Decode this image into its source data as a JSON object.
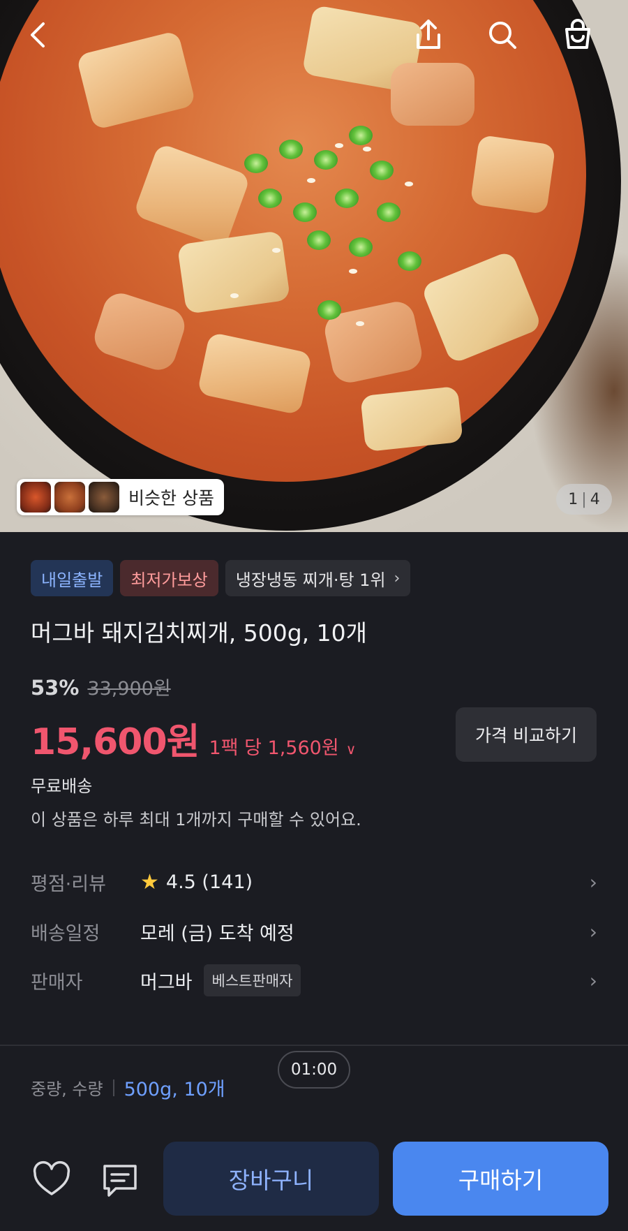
{
  "hero": {
    "similar_label": "비슷한 상품",
    "page_current": "1",
    "page_total": "4"
  },
  "badges": [
    {
      "label": "내일출발"
    },
    {
      "label": "최저가보상"
    },
    {
      "label": "냉장냉동 찌개·탕 1위"
    }
  ],
  "product": {
    "title": "머그바 돼지김치찌개, 500g, 10개",
    "discount_rate": "53%",
    "original_price": "33,900원",
    "sale_price": "15,600원",
    "unit_price": "1팩 당 1,560원",
    "compare_label": "가격 비교하기",
    "shipping": "무료배송",
    "purchase_limit": "이 상품은 하루 최대 1개까지 구매할 수 있어요."
  },
  "info": {
    "rating_label": "평점·리뷰",
    "rating_value": "4.5 (141)",
    "delivery_label": "배송일정",
    "delivery_value": "모레 (금) 도착 예정",
    "seller_label": "판매자",
    "seller_value": "머그바",
    "seller_badge": "베스트판매자"
  },
  "option": {
    "label": "중량, 수량",
    "value": "500g, 10개",
    "timer": "01:00"
  },
  "actions": {
    "cart_label": "장바구니",
    "buy_label": "구매하기"
  },
  "icons": {
    "back": "back-arrow-icon",
    "share": "share-icon",
    "search": "search-icon",
    "cart": "shopping-bag-icon",
    "heart": "heart-icon",
    "chat": "chat-icon",
    "star": "star-icon"
  },
  "colors": {
    "background": "#1b1c22",
    "price_red": "#f0566e",
    "accent_blue": "#4a87ef",
    "rating_star": "#ffc93c"
  }
}
